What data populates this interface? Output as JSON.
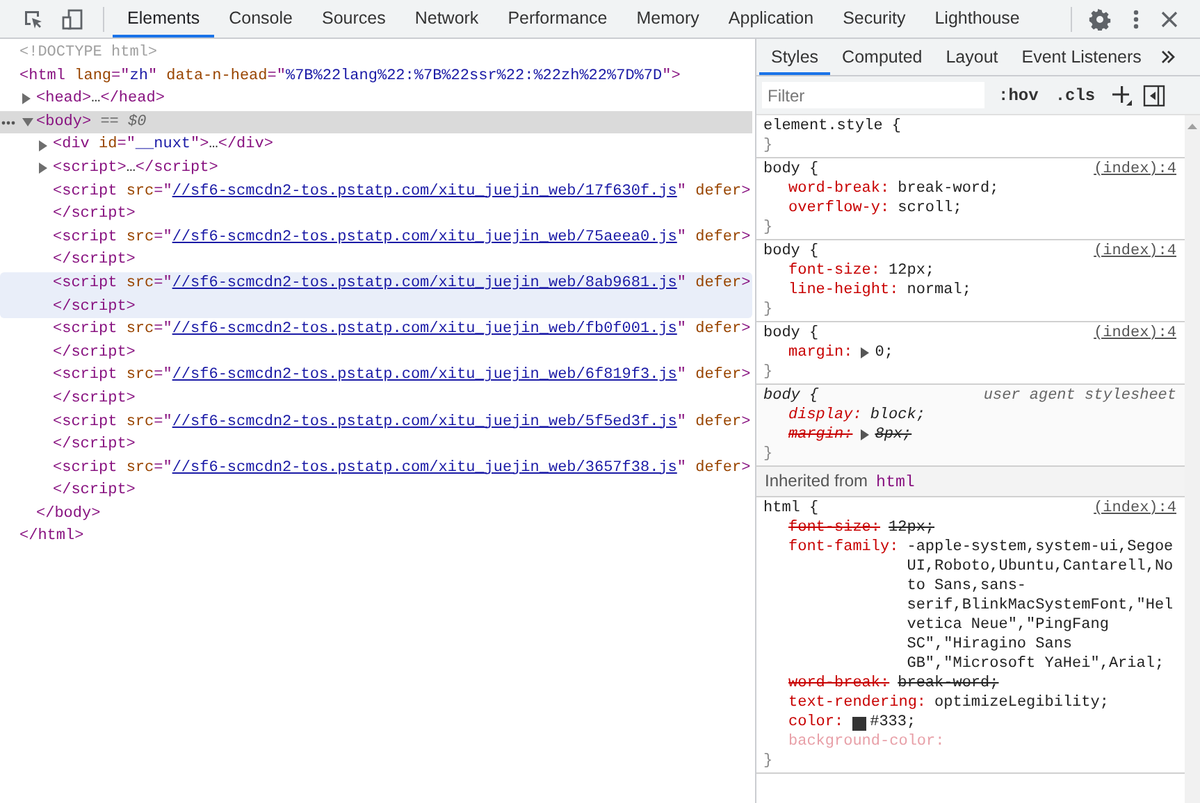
{
  "toolbar": {
    "tabs": [
      {
        "label": "Elements",
        "selected": true
      },
      {
        "label": "Console",
        "selected": false
      },
      {
        "label": "Sources",
        "selected": false
      },
      {
        "label": "Network",
        "selected": false
      },
      {
        "label": "Performance",
        "selected": false
      },
      {
        "label": "Memory",
        "selected": false
      },
      {
        "label": "Application",
        "selected": false
      },
      {
        "label": "Security",
        "selected": false
      },
      {
        "label": "Lighthouse",
        "selected": false
      }
    ]
  },
  "dom": [
    {
      "kind": "leaf",
      "selected": false,
      "hovered": false,
      "open": [
        {
          "t": "<!DOCTYPE html>",
          "kind": "doc"
        }
      ]
    },
    {
      "kind": "root",
      "selected": false,
      "hovered": false,
      "open": [
        {
          "t": "<html",
          "kind": "tag"
        },
        {
          "t": " lang",
          "kind": "attr"
        },
        {
          "t": "=\"",
          "kind": "tag"
        },
        {
          "t": "zh",
          "kind": "val"
        },
        {
          "t": "\"",
          "kind": "tag"
        },
        {
          "t": " data-n-head",
          "kind": "attr"
        },
        {
          "t": "=\"",
          "kind": "tag"
        },
        {
          "t": "%7B%22lang%22:%7B%22ssr%22:%22zh%22%7D%7D",
          "kind": "val"
        },
        {
          "t": "\">",
          "kind": "tag"
        }
      ],
      "close": [
        {
          "t": "</html>",
          "kind": "tag"
        }
      ],
      "children": [
        {
          "kind": "collapsed",
          "selected": false,
          "hovered": false,
          "open": [
            {
              "t": "<head>",
              "kind": "tag"
            },
            {
              "t": "…",
              "kind": "plain"
            },
            {
              "t": "</head>",
              "kind": "tag"
            }
          ]
        },
        {
          "kind": "expanded",
          "selected": true,
          "hovered": false,
          "open": [
            {
              "t": "<body>",
              "kind": "tag"
            },
            {
              "t": " == ",
              "kind": "meta"
            },
            {
              "t": "$0",
              "kind": "metai"
            }
          ],
          "close": [
            {
              "t": "</body>",
              "kind": "tag"
            }
          ],
          "children": [
            {
              "kind": "collapsed",
              "selected": false,
              "hovered": false,
              "open": [
                {
                  "t": "<div",
                  "kind": "tag"
                },
                {
                  "t": " id",
                  "kind": "attr"
                },
                {
                  "t": "=\"",
                  "kind": "tag"
                },
                {
                  "t": "__nuxt",
                  "kind": "val"
                },
                {
                  "t": "\">",
                  "kind": "tag"
                },
                {
                  "t": "…",
                  "kind": "plain"
                },
                {
                  "t": "</div>",
                  "kind": "tag"
                }
              ]
            },
            {
              "kind": "collapsed",
              "selected": false,
              "hovered": false,
              "open": [
                {
                  "t": "<script>",
                  "kind": "tag"
                },
                {
                  "t": "…",
                  "kind": "plain"
                },
                {
                  "t": "</script>",
                  "kind": "tag"
                }
              ]
            },
            {
              "kind": "leaf",
              "selected": false,
              "hovered": false,
              "open": [
                {
                  "t": "<script",
                  "kind": "tag"
                },
                {
                  "t": " src",
                  "kind": "attr"
                },
                {
                  "t": "=\"",
                  "kind": "tag"
                },
                {
                  "t": "//sf6-scmcdn2-tos.pstatp.com/xitu_juejin_web/17f630f.js",
                  "kind": "link"
                },
                {
                  "t": "\"",
                  "kind": "tag"
                },
                {
                  "t": " defer",
                  "kind": "attr"
                },
                {
                  "t": ">",
                  "kind": "tag"
                }
              ],
              "close": [
                {
                  "t": "</script>",
                  "kind": "tag"
                }
              ]
            },
            {
              "kind": "leaf",
              "selected": false,
              "hovered": false,
              "open": [
                {
                  "t": "<script",
                  "kind": "tag"
                },
                {
                  "t": " src",
                  "kind": "attr"
                },
                {
                  "t": "=\"",
                  "kind": "tag"
                },
                {
                  "t": "//sf6-scmcdn2-tos.pstatp.com/xitu_juejin_web/75aeea0.js",
                  "kind": "link"
                },
                {
                  "t": "\"",
                  "kind": "tag"
                },
                {
                  "t": " defer",
                  "kind": "attr"
                },
                {
                  "t": ">",
                  "kind": "tag"
                }
              ],
              "close": [
                {
                  "t": "</script>",
                  "kind": "tag"
                }
              ]
            },
            {
              "kind": "leaf",
              "selected": false,
              "hovered": true,
              "open": [
                {
                  "t": "<script",
                  "kind": "tag"
                },
                {
                  "t": " src",
                  "kind": "attr"
                },
                {
                  "t": "=\"",
                  "kind": "tag"
                },
                {
                  "t": "//sf6-scmcdn2-tos.pstatp.com/xitu_juejin_web/8ab9681.js",
                  "kind": "link"
                },
                {
                  "t": "\"",
                  "kind": "tag"
                },
                {
                  "t": " defer",
                  "kind": "attr"
                },
                {
                  "t": ">",
                  "kind": "tag"
                }
              ],
              "close": [
                {
                  "t": "</script>",
                  "kind": "tag"
                }
              ]
            },
            {
              "kind": "leaf",
              "selected": false,
              "hovered": false,
              "open": [
                {
                  "t": "<script",
                  "kind": "tag"
                },
                {
                  "t": " src",
                  "kind": "attr"
                },
                {
                  "t": "=\"",
                  "kind": "tag"
                },
                {
                  "t": "//sf6-scmcdn2-tos.pstatp.com/xitu_juejin_web/fb0f001.js",
                  "kind": "link"
                },
                {
                  "t": "\"",
                  "kind": "tag"
                },
                {
                  "t": " defer",
                  "kind": "attr"
                },
                {
                  "t": ">",
                  "kind": "tag"
                }
              ],
              "close": [
                {
                  "t": "</script>",
                  "kind": "tag"
                }
              ]
            },
            {
              "kind": "leaf",
              "selected": false,
              "hovered": false,
              "open": [
                {
                  "t": "<script",
                  "kind": "tag"
                },
                {
                  "t": " src",
                  "kind": "attr"
                },
                {
                  "t": "=\"",
                  "kind": "tag"
                },
                {
                  "t": "//sf6-scmcdn2-tos.pstatp.com/xitu_juejin_web/6f819f3.js",
                  "kind": "link"
                },
                {
                  "t": "\"",
                  "kind": "tag"
                },
                {
                  "t": " defer",
                  "kind": "attr"
                },
                {
                  "t": ">",
                  "kind": "tag"
                }
              ],
              "close": [
                {
                  "t": "</script>",
                  "kind": "tag"
                }
              ]
            },
            {
              "kind": "leaf",
              "selected": false,
              "hovered": false,
              "open": [
                {
                  "t": "<script",
                  "kind": "tag"
                },
                {
                  "t": " src",
                  "kind": "attr"
                },
                {
                  "t": "=\"",
                  "kind": "tag"
                },
                {
                  "t": "//sf6-scmcdn2-tos.pstatp.com/xitu_juejin_web/5f5ed3f.js",
                  "kind": "link"
                },
                {
                  "t": "\"",
                  "kind": "tag"
                },
                {
                  "t": " defer",
                  "kind": "attr"
                },
                {
                  "t": ">",
                  "kind": "tag"
                }
              ],
              "close": [
                {
                  "t": "</script>",
                  "kind": "tag"
                }
              ]
            },
            {
              "kind": "leaf",
              "selected": false,
              "hovered": false,
              "open": [
                {
                  "t": "<script",
                  "kind": "tag"
                },
                {
                  "t": " src",
                  "kind": "attr"
                },
                {
                  "t": "=\"",
                  "kind": "tag"
                },
                {
                  "t": "//sf6-scmcdn2-tos.pstatp.com/xitu_juejin_web/3657f38.js",
                  "kind": "link"
                },
                {
                  "t": "\"",
                  "kind": "tag"
                },
                {
                  "t": " defer",
                  "kind": "attr"
                },
                {
                  "t": ">",
                  "kind": "tag"
                }
              ],
              "close": [
                {
                  "t": "</script>",
                  "kind": "tag"
                }
              ]
            }
          ]
        }
      ]
    }
  ],
  "sidebar": {
    "tabs": [
      {
        "label": "Styles",
        "selected": true
      },
      {
        "label": "Computed",
        "selected": false
      },
      {
        "label": "Layout",
        "selected": false
      },
      {
        "label": "Event Listeners",
        "selected": false
      }
    ],
    "filter": {
      "placeholder": "Filter"
    },
    "buttons": [
      ":hov",
      ".cls"
    ],
    "sections": [
      {
        "kind": "rule",
        "user_agent": false,
        "selector": "element.style {",
        "close": "}"
      },
      {
        "kind": "rule",
        "user_agent": false,
        "selector": "body {",
        "source": "(index):4",
        "close": "}",
        "props": [
          {
            "name": "word-break:",
            "value": "break-word;",
            "struck": false,
            "inactive": false,
            "expandable": false
          },
          {
            "name": "overflow-y:",
            "value": "scroll;",
            "struck": false,
            "inactive": false,
            "expandable": false
          }
        ]
      },
      {
        "kind": "rule",
        "user_agent": false,
        "selector": "body {",
        "source": "(index):4",
        "close": "}",
        "props": [
          {
            "name": "font-size:",
            "value": "12px;",
            "struck": false,
            "inactive": false,
            "expandable": false
          },
          {
            "name": "line-height:",
            "value": "normal;",
            "struck": false,
            "inactive": false,
            "expandable": false
          }
        ]
      },
      {
        "kind": "rule",
        "user_agent": false,
        "selector": "body {",
        "source": "(index):4",
        "close": "}",
        "props": [
          {
            "name": "margin:",
            "value": "0;",
            "struck": false,
            "inactive": false,
            "expandable": true
          }
        ]
      },
      {
        "kind": "rule",
        "user_agent": true,
        "selector": "body {",
        "source": "user agent stylesheet",
        "close": "}",
        "props": [
          {
            "name": "display:",
            "value": "block;",
            "struck": false,
            "inactive": false,
            "expandable": false
          },
          {
            "name": "margin:",
            "value": "8px;",
            "struck": true,
            "inactive": false,
            "expandable": true
          }
        ]
      },
      {
        "kind": "inherited",
        "label": "Inherited from",
        "element": "html"
      },
      {
        "kind": "rule",
        "user_agent": false,
        "selector": "html {",
        "source": "(index):4",
        "close": "}",
        "props": [
          {
            "name": "font-size:",
            "value": "12px;",
            "struck": true,
            "inactive": false,
            "expandable": false
          },
          {
            "name": "font-family:",
            "value": "-apple-system,system-ui,Segoe UI,Roboto,Ubuntu,Cantarell,Noto Sans,sans-serif,BlinkMacSystemFont,\"Helvetica Neue\",\"PingFang SC\",\"Hiragino Sans GB\",\"Microsoft YaHei\",Arial;",
            "struck": false,
            "inactive": false,
            "expandable": false
          },
          {
            "name": "word-break:",
            "value": "break-word;",
            "struck": true,
            "inactive": false,
            "expandable": false
          },
          {
            "name": "text-rendering:",
            "value": "optimizeLegibility;",
            "struck": false,
            "inactive": false,
            "expandable": false
          },
          {
            "name": "color:",
            "value": "#333;",
            "color": "#333333",
            "struck": false,
            "inactive": false,
            "expandable": false
          },
          {
            "name": "background-color:",
            "struck": false,
            "inactive": true,
            "expandable": false
          }
        ]
      }
    ]
  }
}
